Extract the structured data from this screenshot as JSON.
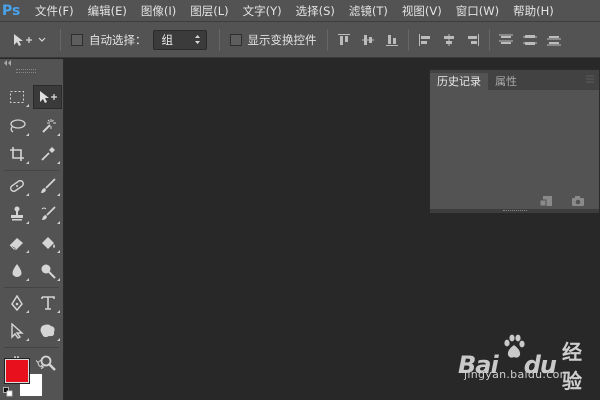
{
  "app": {
    "logo": "Ps"
  },
  "menu": [
    {
      "label": "文件(F)"
    },
    {
      "label": "编辑(E)"
    },
    {
      "label": "图像(I)"
    },
    {
      "label": "图层(L)"
    },
    {
      "label": "文字(Y)"
    },
    {
      "label": "选择(S)"
    },
    {
      "label": "滤镜(T)"
    },
    {
      "label": "视图(V)"
    },
    {
      "label": "窗口(W)"
    },
    {
      "label": "帮助(H)"
    }
  ],
  "options": {
    "tool_icon": "move-tool-icon",
    "auto_select_label": "自动选择：",
    "auto_select_checked": false,
    "auto_select_value": "组",
    "show_transform_label": "显示变换控件",
    "show_transform_checked": false,
    "align_buttons": [
      "align-top-icon",
      "align-vcenter-icon",
      "align-bottom-icon",
      "align-left-icon",
      "align-hcenter-icon",
      "align-right-icon",
      "distribute-top-icon",
      "distribute-vcenter-icon",
      "distribute-bottom-icon"
    ]
  },
  "toolbox": {
    "tools": [
      [
        "rect-marquee-icon",
        "move-icon"
      ],
      [
        "lasso-icon",
        "magic-wand-icon"
      ],
      [
        "crop-icon",
        "eyedropper-icon"
      ],
      [
        "healing-brush-icon",
        "brush-icon"
      ],
      [
        "clone-stamp-icon",
        "history-brush-icon"
      ],
      [
        "eraser-icon",
        "paint-bucket-icon"
      ],
      [
        "blur-icon",
        "dodge-icon"
      ],
      [
        "pen-icon",
        "type-icon"
      ],
      [
        "path-select-icon",
        "custom-shape-icon"
      ],
      [
        "hand-icon",
        "zoom-icon"
      ]
    ],
    "active_tool": "move-icon",
    "foreground_color": "#e8101c",
    "background_color": "#ffffff"
  },
  "history_panel": {
    "tabs": [
      {
        "label": "历史记录",
        "active": true
      },
      {
        "label": "属性",
        "active": false
      }
    ]
  },
  "watermark": {
    "brand_left": "Bai",
    "brand_right": "du",
    "brand_cn": "经验",
    "url": "jingyan.baidu.com"
  }
}
